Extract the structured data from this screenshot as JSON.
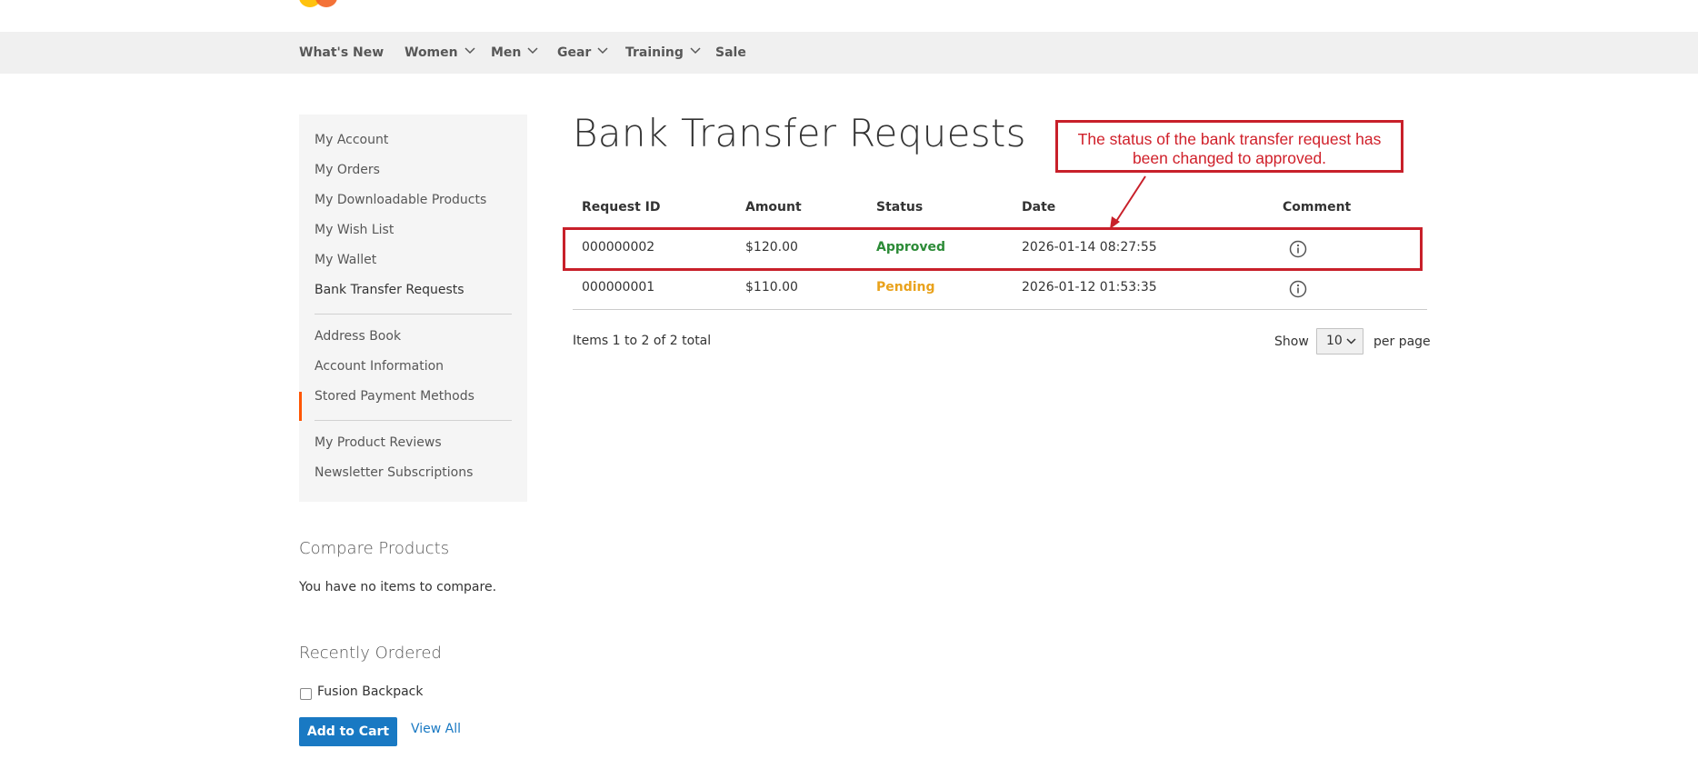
{
  "nav": {
    "items": [
      {
        "label": "What's New",
        "has_dropdown": false
      },
      {
        "label": "Women",
        "has_dropdown": true
      },
      {
        "label": "Men",
        "has_dropdown": true
      },
      {
        "label": "Gear",
        "has_dropdown": true
      },
      {
        "label": "Training",
        "has_dropdown": true
      },
      {
        "label": "Sale",
        "has_dropdown": false
      }
    ]
  },
  "sidebar": {
    "active_item": "Bank Transfer Requests",
    "items": [
      {
        "label": "My Account"
      },
      {
        "label": "My Orders"
      },
      {
        "label": "My Downloadable Products"
      },
      {
        "label": "My Wish List"
      },
      {
        "label": "My Wallet"
      },
      {
        "label": "Bank Transfer Requests"
      },
      {
        "label": "Address Book"
      },
      {
        "label": "Account Information"
      },
      {
        "label": "Stored Payment Methods"
      },
      {
        "label": "My Product Reviews"
      },
      {
        "label": "Newsletter Subscriptions"
      }
    ]
  },
  "compare": {
    "title": "Compare Products",
    "empty_text": "You have no items to compare."
  },
  "recently_ordered": {
    "title": "Recently Ordered",
    "item_label": "Fusion Backpack",
    "add_to_cart_label": "Add to Cart",
    "view_all_label": "View All"
  },
  "main": {
    "title": "Bank Transfer Requests",
    "table": {
      "headers": [
        "Request ID",
        "Amount",
        "Status",
        "Date",
        "Comment"
      ],
      "rows": [
        {
          "id": "000000002",
          "amount": "$120.00",
          "status": "Approved",
          "date": "2026-01-14 08:27:55"
        },
        {
          "id": "000000001",
          "amount": "$110.00",
          "status": "Pending",
          "date": "2026-01-12 01:53:35"
        }
      ]
    },
    "pager": {
      "items_text": "Items 1 to 2 of 2 total",
      "show_label": "Show",
      "limit_value": "10",
      "per_page_label": "per page"
    }
  },
  "annotation": {
    "text": "The status of the bank transfer request has been changed to approved."
  },
  "colors": {
    "accent": "#1979c3",
    "active_marker": "#ff5501",
    "approved": "#2c8b37",
    "pending": "#e9a21c",
    "annotation": "#c8202a"
  },
  "icons": {
    "comment": "info-icon",
    "dropdown": "chevron-down-icon"
  }
}
